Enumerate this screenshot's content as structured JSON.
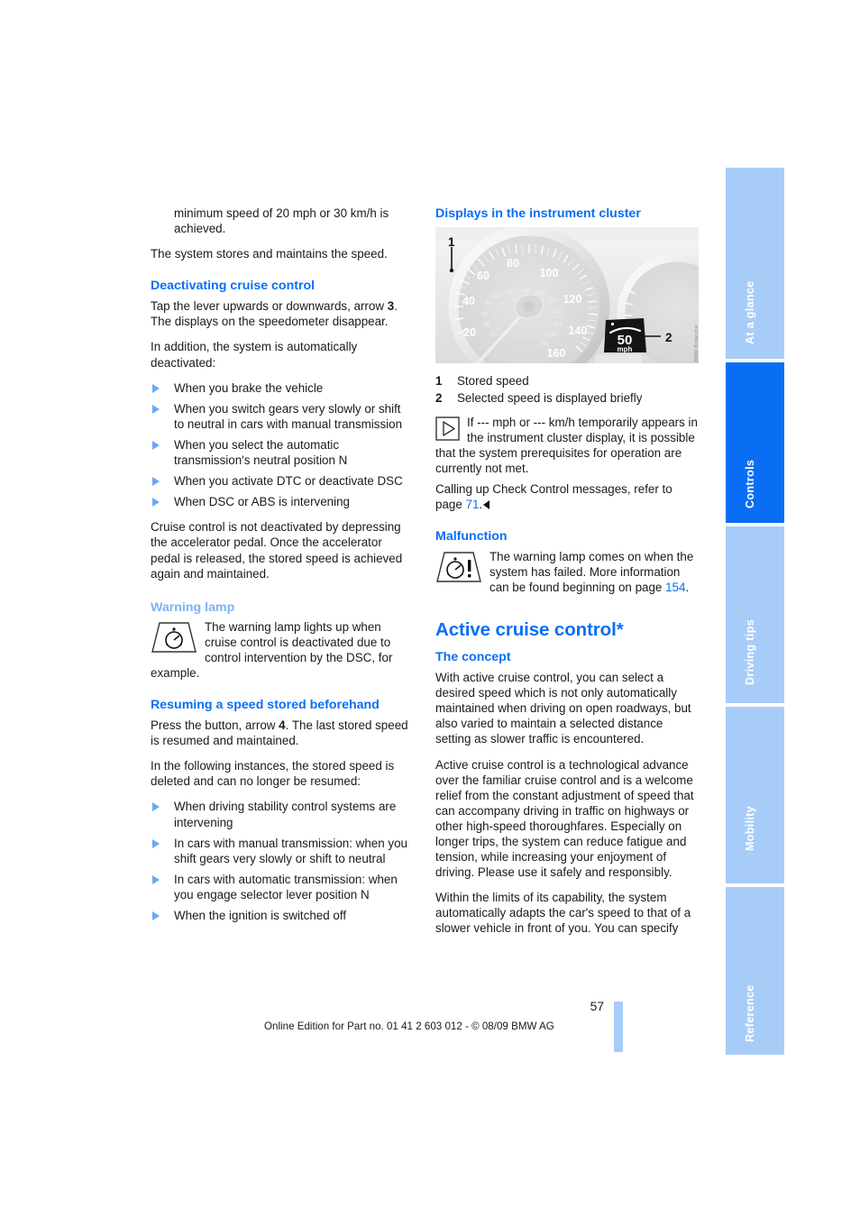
{
  "page": {
    "number": "57",
    "footer_text": "Online Edition for Part no. 01 41 2 603 012 - © 08/09 BMW AG"
  },
  "colors": {
    "heading_blue": "#0a6ef5",
    "subheading_blue": "#7db3f5",
    "tab_inactive": "#a8ccf8",
    "tab_active": "#0a6ef5",
    "bullet_blue": "#6aa9f2"
  },
  "sidebar": {
    "tabs": [
      {
        "label": "At a glance",
        "active": false
      },
      {
        "label": "Controls",
        "active": true
      },
      {
        "label": "Driving tips",
        "active": false
      },
      {
        "label": "Mobility",
        "active": false
      },
      {
        "label": "Reference",
        "active": false
      }
    ]
  },
  "left_column": {
    "continued_paragraph": "minimum speed of 20 mph or 30 km/h is achieved.",
    "para_stores": "The system stores and maintains the speed.",
    "deactivating": {
      "heading": "Deactivating cruise control",
      "para_tap_pre": "Tap the lever upwards or downwards, arrow ",
      "para_tap_bold": "3",
      "para_tap_post": ". The displays on the speedometer disappear.",
      "para_inaddition": "In addition, the system is automatically deactivated:",
      "bullets": [
        "When you brake the vehicle",
        "When you switch gears very slowly or shift to neutral in cars with manual transmission",
        "When you select the automatic transmission's neutral position N",
        "When you activate DTC or deactivate DSC",
        "When DSC or ABS is intervening"
      ],
      "para_not_deactivated": "Cruise control is not deactivated by depressing the accelerator pedal. Once the accelerator pedal is released, the stored speed is achieved again and maintained."
    },
    "warning_lamp": {
      "heading": "Warning lamp",
      "icon": "cruise-control-warning-lamp-icon",
      "text": "The warning lamp lights up when cruise control is deactivated due to control intervention by the DSC, for example."
    },
    "resuming": {
      "heading": "Resuming a speed stored beforehand",
      "para_press_pre": "Press the button, arrow ",
      "para_press_bold": "4",
      "para_press_post": ". The last stored speed is resumed and maintained.",
      "para_following": "In the following instances, the stored speed is deleted and can no longer be resumed:",
      "bullets": [
        "When driving stability control systems are intervening",
        "In cars with manual transmission: when you shift gears very slowly or shift to neutral",
        "In cars with automatic transmission: when you engage selector lever position N",
        "When the ignition is switched off"
      ]
    }
  },
  "right_column": {
    "displays": {
      "heading": "Displays in the instrument cluster",
      "figure": {
        "name": "instrument-cluster-figure",
        "callouts": [
          "1",
          "2"
        ],
        "speedometer_labels": [
          "20",
          "40",
          "60",
          "80",
          "100",
          "120",
          "140",
          "160"
        ],
        "inner_scale_labels": [
          "40",
          "60",
          "80",
          "100",
          "120",
          "140",
          "160",
          "180",
          "200",
          "220",
          "240",
          "260"
        ],
        "display_speed": "50",
        "display_unit": "mph",
        "side_caption": "BMW-Bildarchiv"
      },
      "legend": [
        {
          "num": "1",
          "text": "Stored speed"
        },
        {
          "num": "2",
          "text": "Selected speed is displayed briefly"
        }
      ],
      "note_icon": "note-play-triangle-icon",
      "note_text": "If --- mph or --- km/h temporarily appears in the instrument cluster display, it is possible that the system prerequisites for operation are currently not met.",
      "checkcontrol_pre": "Calling up Check Control messages, refer to page ",
      "checkcontrol_page": "71",
      "checkcontrol_post": "."
    },
    "malfunction": {
      "heading": "Malfunction",
      "icon": "cruise-control-malfunction-lamp-icon",
      "text_pre": "The warning lamp comes on when the system has failed. More information can be found beginning on page ",
      "page_ref": "154",
      "text_post": "."
    },
    "active_cruise": {
      "title": "Active cruise control*",
      "concept_heading": "The concept",
      "para1": "With active cruise control, you can select a desired speed which is not only automatically maintained when driving on open roadways, but also varied to maintain a selected distance setting as slower traffic is encountered.",
      "para2": "Active cruise control is a technological advance over the familiar cruise control and is a welcome relief from the constant adjustment of speed that can accompany driving in traffic on highways or other high-speed thoroughfares. Especially on longer trips, the system can reduce fatigue and tension, while increasing your enjoyment of driving. Please use it safely and responsibly.",
      "para3": "Within the limits of its capability, the system automatically adapts the car's speed to that of a slower vehicle in front of you. You can specify"
    }
  }
}
